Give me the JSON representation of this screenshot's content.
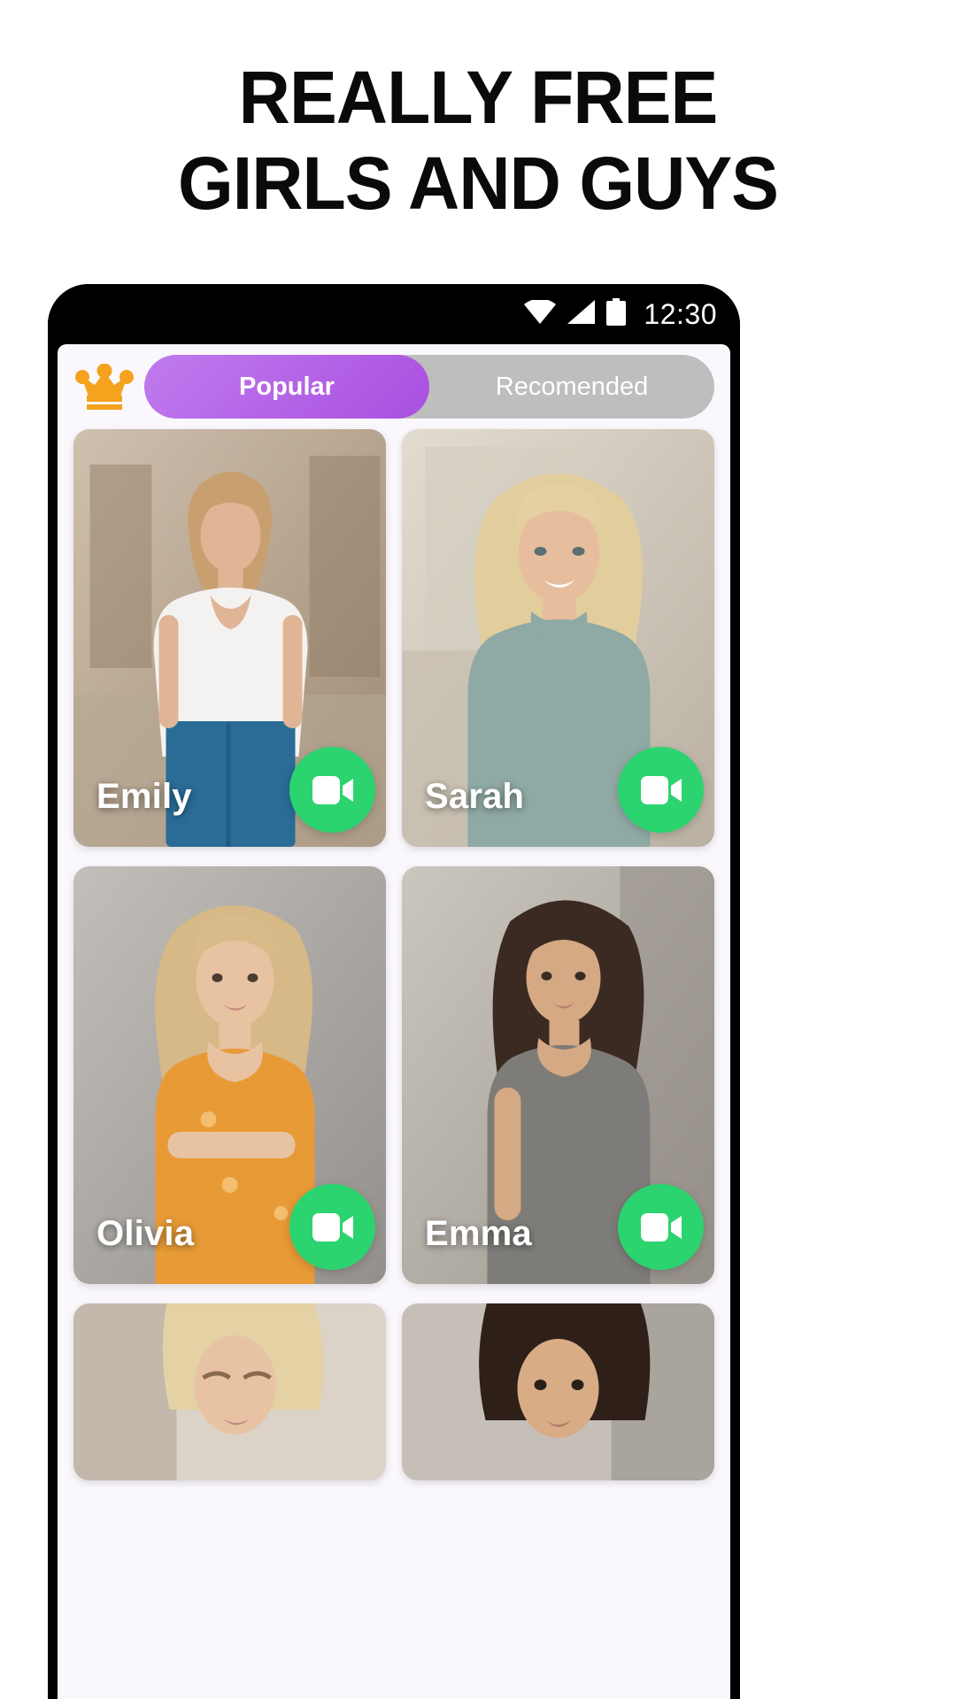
{
  "headline": {
    "line1": "REALLY FREE",
    "line2": "GIRLS AND GUYS"
  },
  "phone": {
    "status_bar": {
      "time": "12:30",
      "icons": [
        "wifi-icon",
        "signal-icon",
        "battery-icon"
      ]
    }
  },
  "app": {
    "crown_icon": "crown-icon",
    "tabs": [
      {
        "label": "Popular",
        "active": true
      },
      {
        "label": "Recomended",
        "active": false
      }
    ],
    "call_button_label": "video-call-icon",
    "cards": [
      {
        "name": "Emily",
        "skin": "#E0B596",
        "hair": "#C8A070",
        "cloth": "#F2F0EE",
        "bg1": "#CDBCA9",
        "bg2": "#A9937C",
        "lower": "#2A6C96"
      },
      {
        "name": "Sarah",
        "skin": "#E6BE9E",
        "hair": "#E2CE9C",
        "cloth": "#8FA9A4",
        "bg1": "#DDD8CE",
        "bg2": "#BEB6A8",
        "lower": "#8FA9A4"
      },
      {
        "name": "Olivia",
        "skin": "#E8C3A2",
        "hair": "#D7B887",
        "cloth": "#E79A36",
        "bg1": "#B8B6B4",
        "bg2": "#9A9896",
        "lower": "#E79A36"
      },
      {
        "name": "Emma",
        "skin": "#D5A983",
        "hair": "#3B2A22",
        "cloth": "#7D7C78",
        "bg1": "#C5C1BA",
        "bg2": "#A6A29A",
        "lower": "#7D7C78"
      },
      {
        "name": "",
        "skin": "#E7C3A4",
        "hair": "#E4D1A4",
        "cloth": "#EDE8E4",
        "bg1": "#D8CFC6",
        "bg2": "#B6ACA1",
        "lower": "#EDE8E4"
      },
      {
        "name": "",
        "skin": "#D8AC85",
        "hair": "#2E2019",
        "cloth": "#3A3A3C",
        "bg1": "#BFB9B2",
        "bg2": "#9C9790",
        "lower": "#3A3A3C"
      }
    ],
    "colors": {
      "accent_purple": "#A94FE0",
      "tab_track": "#BEBEBE",
      "crown_orange": "#F5A21F",
      "call_green": "#2BD46E",
      "screen_bg": "#FAF8FC"
    }
  }
}
